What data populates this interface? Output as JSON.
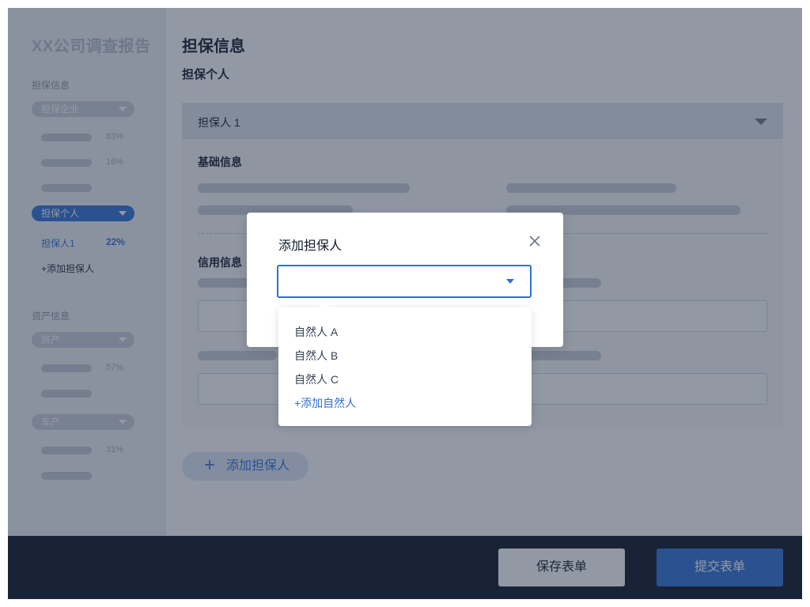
{
  "sidebar": {
    "brand": "XX公司调查报告",
    "sections": [
      {
        "label": "担保信息",
        "groups": [
          {
            "label": "担保企业",
            "rows": [
              {
                "pct": "83%"
              },
              {
                "pct": "16%"
              },
              {
                "pct": ""
              }
            ]
          },
          {
            "label": "担保个人",
            "active": true,
            "items": [
              {
                "label": "担保人1",
                "pct": "22%"
              }
            ],
            "add_label": "+添加担保人"
          }
        ]
      },
      {
        "label": "资产信息",
        "groups": [
          {
            "label": "房产",
            "rows": [
              {
                "pct": "57%"
              },
              {
                "pct": ""
              }
            ]
          },
          {
            "label": "车产",
            "rows": [
              {
                "pct": "31%"
              },
              {
                "pct": ""
              }
            ]
          }
        ]
      }
    ]
  },
  "main": {
    "title": "担保信息",
    "subtitle": "担保个人",
    "card": {
      "header": "担保人 1",
      "basic_title": "基础信息",
      "credit_title": "信用信息"
    },
    "add_button": {
      "icon": "plus-icon",
      "label": "添加担保人"
    }
  },
  "footer": {
    "save_label": "保存表单",
    "submit_label": "提交表单"
  },
  "modal": {
    "title": "添加担保人",
    "close_icon": "close-icon",
    "select_value": "",
    "options": [
      "自然人 A",
      "自然人 B",
      "自然人 C"
    ],
    "add_option": "+添加自然人"
  },
  "colors": {
    "accent": "#2d6fd6",
    "footer_bg": "#0b1226",
    "overlay": "#28344a"
  }
}
